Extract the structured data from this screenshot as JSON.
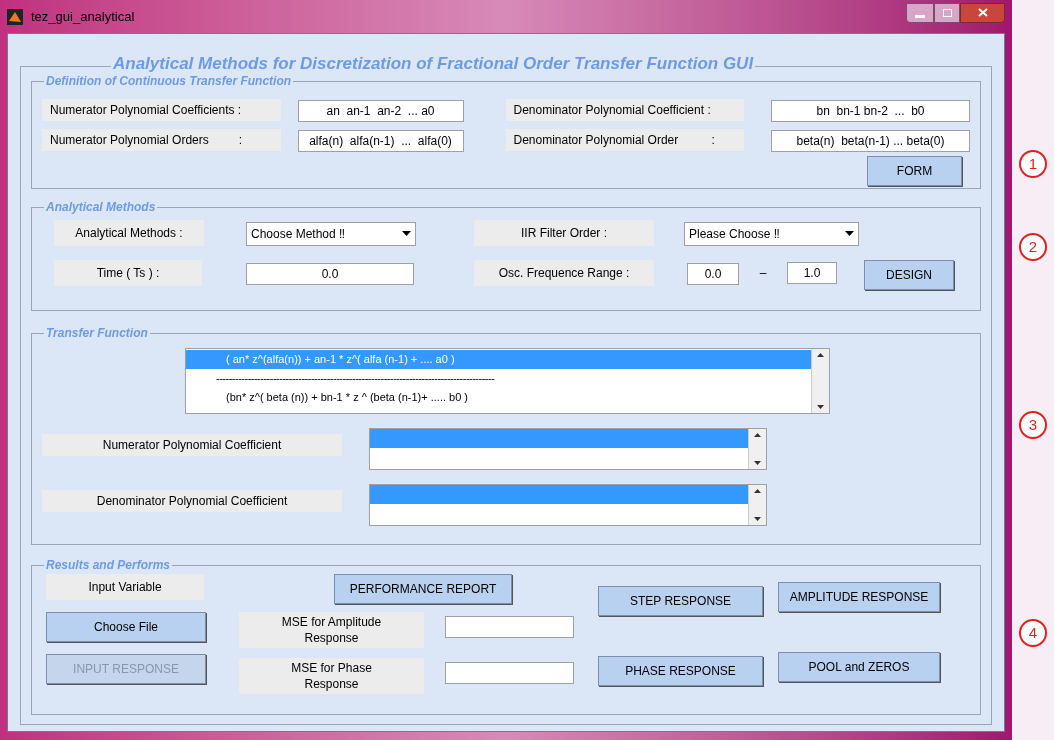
{
  "window": {
    "title": "tez_gui_analytical"
  },
  "main_title": "Analytical Methods for Discretization of Fractional Order Transfer Function GUI",
  "definition": {
    "title": "Definition of Continuous Transfer Function",
    "rows": [
      [
        {
          "label": "Numerator Polynomial Coefficients :",
          "value": "an  an-1  an-2  ... a0"
        },
        {
          "label": "Denominator Polynomial Coefficient :",
          "value": "bn  bn-1 bn-2  ...  b0"
        }
      ],
      [
        {
          "label": "Numerator Polynomial Orders         :",
          "value": "alfa(n)  alfa(n-1)  ...  alfa(0)"
        },
        {
          "label": "Denominator Polynomial Order          :",
          "value": "beta(n)  beta(n-1) ... beta(0)"
        }
      ]
    ],
    "button": {
      "label": "FORM",
      "disabled": false
    }
  },
  "analytical": {
    "title": "Analytical Methods",
    "method_label": "Analytical Methods :",
    "method_value": "Choose Method ‼",
    "iir_label": "IIR Filter Order :",
    "iir_value": "Please Choose ‼",
    "time_label": "Time ( Ts ) :",
    "time_value": "0.0",
    "range_label": "Osc. Frequence Range :",
    "range_from": "0.0",
    "range_sep": "–",
    "range_to": "1.0",
    "button": {
      "label": "DESIGN",
      "disabled": false
    }
  },
  "transfer": {
    "title": "Transfer Function",
    "lines": [
      {
        "text": "( an* z^(alfa(n))  +  an-1 * z^( alfa (n-1)  + ....  a0  )",
        "selected": true
      },
      {
        "text": "----------------------------------------------------------------------------------------",
        "selected": false
      },
      {
        "text": "(bn* z^( beta (n)) + bn-1 * z ^ (beta (n-1)+ .....  b0 )",
        "selected": false
      }
    ],
    "lists": [
      {
        "label": "Numerator Polynomial Coefficient",
        "highlighted": true
      },
      {
        "label": "Denominator Polynomial Coefficient",
        "highlighted": true
      }
    ]
  },
  "results": {
    "title": "Results and Performs",
    "input_label": "Input Variable",
    "performance_button": {
      "label": "PERFORMANCE REPORT",
      "disabled": false
    },
    "step_button": {
      "label": "STEP RESPONSE",
      "disabled": false
    },
    "amplitude_button": {
      "label": "AMPLITUDE RESPONSE",
      "disabled": false
    },
    "choose_button": {
      "label": "Choose File",
      "disabled": false
    },
    "input_response_button": {
      "label": "INPUT RESPONSE",
      "disabled": true
    },
    "mse_amplitude_label": "MSE for Amplitude Response",
    "mse_phase_label": "MSE for Phase Response",
    "phase_button": {
      "label": "PHASE RESPONSE",
      "disabled": false
    },
    "pool_button": {
      "label": "POOL and ZEROS",
      "disabled": false
    }
  },
  "annotations": [
    "1",
    "2",
    "3",
    "4"
  ]
}
